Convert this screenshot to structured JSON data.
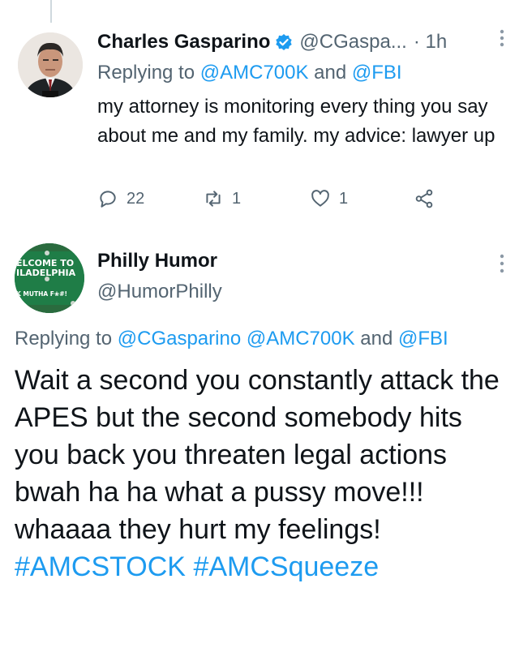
{
  "tweet1": {
    "name": "Charles Gasparino",
    "handle": "@CGaspa...",
    "time": "· 1h",
    "replying_prefix": "Replying to ",
    "replying_to_1": "@AMC700K",
    "replying_and": " and ",
    "replying_to_2": "@FBI",
    "body": "my attorney is monitoring every thing you say about me and my family. my advice: lawyer up",
    "reply_count": "22",
    "retweet_count": "1",
    "like_count": "1"
  },
  "tweet2": {
    "name": "Philly Humor",
    "handle": "@HumorPhilly",
    "avatar_text_1": "ELCOME TO",
    "avatar_text_2": "ILADELPHIA",
    "avatar_text_3": "K MUTHA F❀#!",
    "replying_prefix": "Replying to ",
    "replying_to_1": "@CGasparino",
    "replying_to_2": "@AMC700K",
    "replying_and": " and ",
    "replying_to_3": "@FBI",
    "body": "Wait a second you constantly attack the APES but the second somebody hits you back you threaten legal actions bwah ha ha what a pussy move!!! whaaaa they hurt my feelings! ",
    "hashtag_1": "#AMCSTOCK",
    "hashtag_2": "#AMCSqueeze"
  },
  "icons": [
    "verified-badge-icon",
    "more-icon",
    "reply-icon",
    "retweet-icon",
    "like-icon",
    "share-icon"
  ],
  "colors": {
    "link": "#1d9bf0",
    "secondary": "#536471",
    "text": "#0f1419",
    "avatar_green": "#1e7a45"
  }
}
